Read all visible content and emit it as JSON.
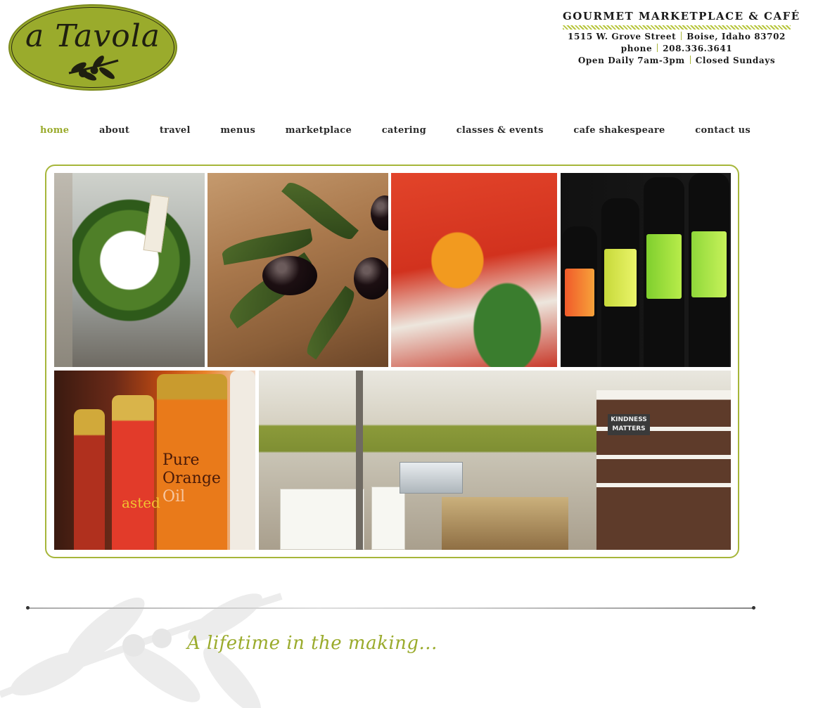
{
  "logo": {
    "text": "a Tavola",
    "color": "#9aab2c"
  },
  "header": {
    "tagline": "GOURMET MARKETPLACE & CAFÉ",
    "address_street": "1515 W. Grove Street",
    "address_city": "Boise, Idaho 83702",
    "phone_label": "phone",
    "phone_number": "208.336.3641",
    "hours_open": "Open Daily 7am-3pm",
    "hours_closed": "Closed Sundays"
  },
  "nav": {
    "items": [
      {
        "label": "home",
        "active": true
      },
      {
        "label": "about"
      },
      {
        "label": "travel"
      },
      {
        "label": "menus"
      },
      {
        "label": "marketplace"
      },
      {
        "label": "catering"
      },
      {
        "label": "classes & events"
      },
      {
        "label": "cafe shakespeare"
      },
      {
        "label": "contact us"
      }
    ],
    "active_color": "#9aab2c"
  },
  "collage": {
    "frame_color": "#a6b63a",
    "photos": [
      {
        "name": "boxwood-wreath-photo"
      },
      {
        "name": "olive-branch-photo"
      },
      {
        "name": "tomato-salad-photo"
      },
      {
        "name": "olive-oil-bottles-photo"
      },
      {
        "name": "infused-oils-photo"
      },
      {
        "name": "marketplace-interior-photo"
      }
    ],
    "bottle_labels": {
      "pure": "Pure",
      "orange": "Orange",
      "oil": "Oil",
      "roasted": "asted",
      "kindness": "KINDNESS MATTERS"
    }
  },
  "footer": {
    "motto": "A lifetime in the making..."
  }
}
